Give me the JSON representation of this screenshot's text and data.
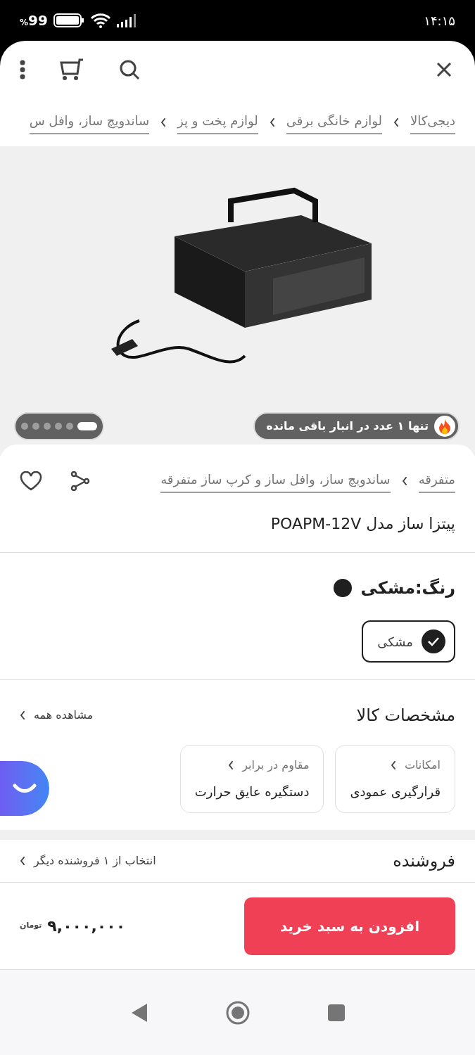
{
  "status_bar": {
    "time": "۱۴:۱۵",
    "battery": "99",
    "battery_unit": "%"
  },
  "breadcrumb": [
    {
      "label": "دیجی‌کالا"
    },
    {
      "label": "لوازم خانگی برقی"
    },
    {
      "label": "لوازم پخت و پز"
    },
    {
      "label": "ساندویچ ساز، وافل س"
    }
  ],
  "gallery": {
    "stock_badge": "تنها ۱ عدد در انبار باقی مانده",
    "dots": [
      {
        "selected": true
      },
      {
        "selected": false
      },
      {
        "selected": false
      },
      {
        "selected": false
      },
      {
        "selected": false
      },
      {
        "selected": false
      }
    ]
  },
  "category_path": [
    {
      "label": "متفرقه"
    },
    {
      "label": "ساندویچ ساز، وافل ساز و کرپ ساز متفرقه"
    }
  ],
  "product_title": "پیتزا ساز مدل POAPM-12V",
  "color_section": {
    "label": "رنگ:",
    "value": "مشکی",
    "options": [
      {
        "label": "مشکی",
        "color": "#1f1f1f",
        "selected": true
      }
    ]
  },
  "specs": {
    "title": "مشخصات کالا",
    "see_all": "مشاهده همه",
    "items": [
      {
        "label": "امکانات",
        "value": "قرارگیری عمودی"
      },
      {
        "label": "مقاوم در برابر",
        "value": "دستگیره عایق حرارت"
      }
    ]
  },
  "seller": {
    "title": "فروشنده",
    "link": "انتخاب از ۱ فروشنده دیگر"
  },
  "purchase_bar": {
    "button": "افزودن به سبد خرید",
    "price": "۹,۰۰۰,۰۰۰",
    "currency": "تومان"
  }
}
